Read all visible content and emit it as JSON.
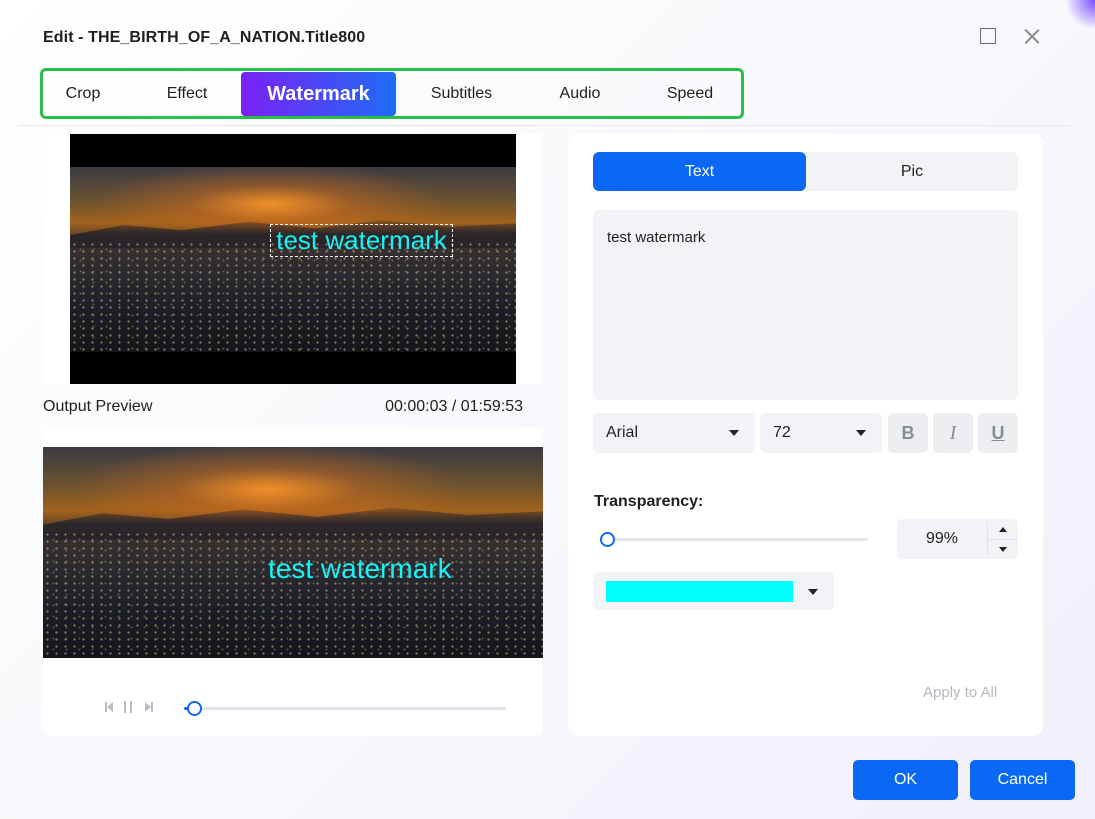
{
  "window": {
    "title": "Edit - THE_BIRTH_OF_A_NATION.Title800"
  },
  "tabs": [
    {
      "label": "Crop",
      "active": false
    },
    {
      "label": "Effect",
      "active": false
    },
    {
      "label": "Watermark",
      "active": true
    },
    {
      "label": "Subtitles",
      "active": false
    },
    {
      "label": "Audio",
      "active": false
    },
    {
      "label": "Speed",
      "active": false
    }
  ],
  "preview": {
    "watermark_text": "test watermark",
    "output_label": "Output Preview",
    "time_display": "00:00:03 / 01:59:53",
    "seek_progress_fraction": 0.03
  },
  "watermark_panel": {
    "mode_tabs": [
      {
        "label": "Text",
        "active": true
      },
      {
        "label": "Pic",
        "active": false
      }
    ],
    "text_value": "test watermark",
    "font": "Arial",
    "size": "72",
    "format_buttons": {
      "bold": "B",
      "italic": "I",
      "underline": "U"
    },
    "transparency_label": "Transparency:",
    "transparency_value": "99%",
    "transparency_fraction": 0.0,
    "text_color": "#00FFFF",
    "apply_to_all": "Apply to All"
  },
  "footer": {
    "ok": "OK",
    "cancel": "Cancel"
  },
  "colors": {
    "accent": "#0A68F5",
    "active_tab_gradient_start": "#7A22F5",
    "highlight_frame": "#2BBD4A",
    "watermark_text": "#14F4F4"
  }
}
